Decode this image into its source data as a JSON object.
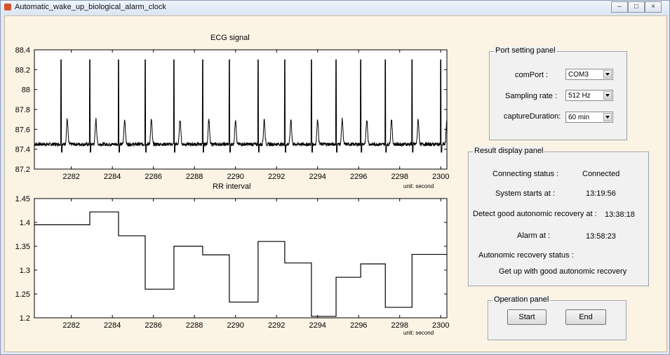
{
  "window": {
    "title": "Automatic_wake_up_biological_alarm_clock",
    "minimize_glyph": "–",
    "maximize_glyph": "□",
    "close_glyph": "×"
  },
  "ecg_axes": {
    "title": "ECG signal",
    "unit_note": "",
    "x_ticks": [
      "2282",
      "2284",
      "2286",
      "2288",
      "2290",
      "2292",
      "2294",
      "2296",
      "2298",
      "2300"
    ],
    "y_ticks": [
      "88.4",
      "88.2",
      "88",
      "87.8",
      "87.6",
      "87.4",
      "87.2"
    ]
  },
  "rr_axes": {
    "title": "RR interval",
    "unit_note_top": "unit: second",
    "unit_note": "unit: second",
    "x_ticks": [
      "2282",
      "2284",
      "2286",
      "2288",
      "2290",
      "2292",
      "2294",
      "2296",
      "2298",
      "2300"
    ],
    "y_ticks": [
      "1.45",
      "1.4",
      "1.35",
      "1.3",
      "1.25",
      "1.2"
    ]
  },
  "chart_data": [
    {
      "type": "line",
      "title": "ECG signal",
      "xlim": [
        2280.2,
        2300.3
      ],
      "ylim": [
        87.2,
        88.4
      ],
      "baseline": 87.45,
      "r_peaks_x": [
        2281.5,
        2282.9,
        2284.3,
        2285.6,
        2287.0,
        2288.4,
        2289.7,
        2291.1,
        2292.4,
        2293.7,
        2294.9,
        2296.1,
        2297.3,
        2298.6,
        2300.0
      ],
      "r_peak_y": 88.3,
      "t_wave_y": 87.7
    },
    {
      "type": "line",
      "title": "RR interval",
      "step": true,
      "xlim": [
        2280.2,
        2300.3
      ],
      "ylim": [
        1.2,
        1.45
      ],
      "x": [
        2280.2,
        2282.9,
        2284.3,
        2285.6,
        2287.0,
        2288.4,
        2289.7,
        2291.1,
        2292.4,
        2293.7,
        2294.9,
        2296.1,
        2297.3,
        2298.6,
        2300.3
      ],
      "values": [
        1.395,
        1.422,
        1.372,
        1.26,
        1.35,
        1.332,
        1.233,
        1.36,
        1.315,
        1.203,
        1.285,
        1.313,
        1.222,
        1.333
      ]
    }
  ],
  "port_panel": {
    "title": "Port setting panel",
    "com_label": "comPort :",
    "com_value": "COM3",
    "rate_label": "Sampling rate :",
    "rate_value": "512 Hz",
    "duration_label": "captureDuration:",
    "duration_value": "60 min"
  },
  "result_panel": {
    "title": "Result display panel",
    "connecting_label": "Connecting status :",
    "connecting_value": "Connected",
    "start_label": "System starts at :",
    "start_value": "13:19:56",
    "detect_label": "Detect good  autonomic  recovery at :",
    "detect_value": "13:38:18",
    "alarm_label": "Alarm at :",
    "alarm_value": "13:58:23",
    "recovery_label": "Autonomic recovery status :",
    "recovery_value": "Get up with good autonomic recovery"
  },
  "operation_panel": {
    "title": "Operation panel",
    "start_label": "Start",
    "end_label": "End"
  }
}
